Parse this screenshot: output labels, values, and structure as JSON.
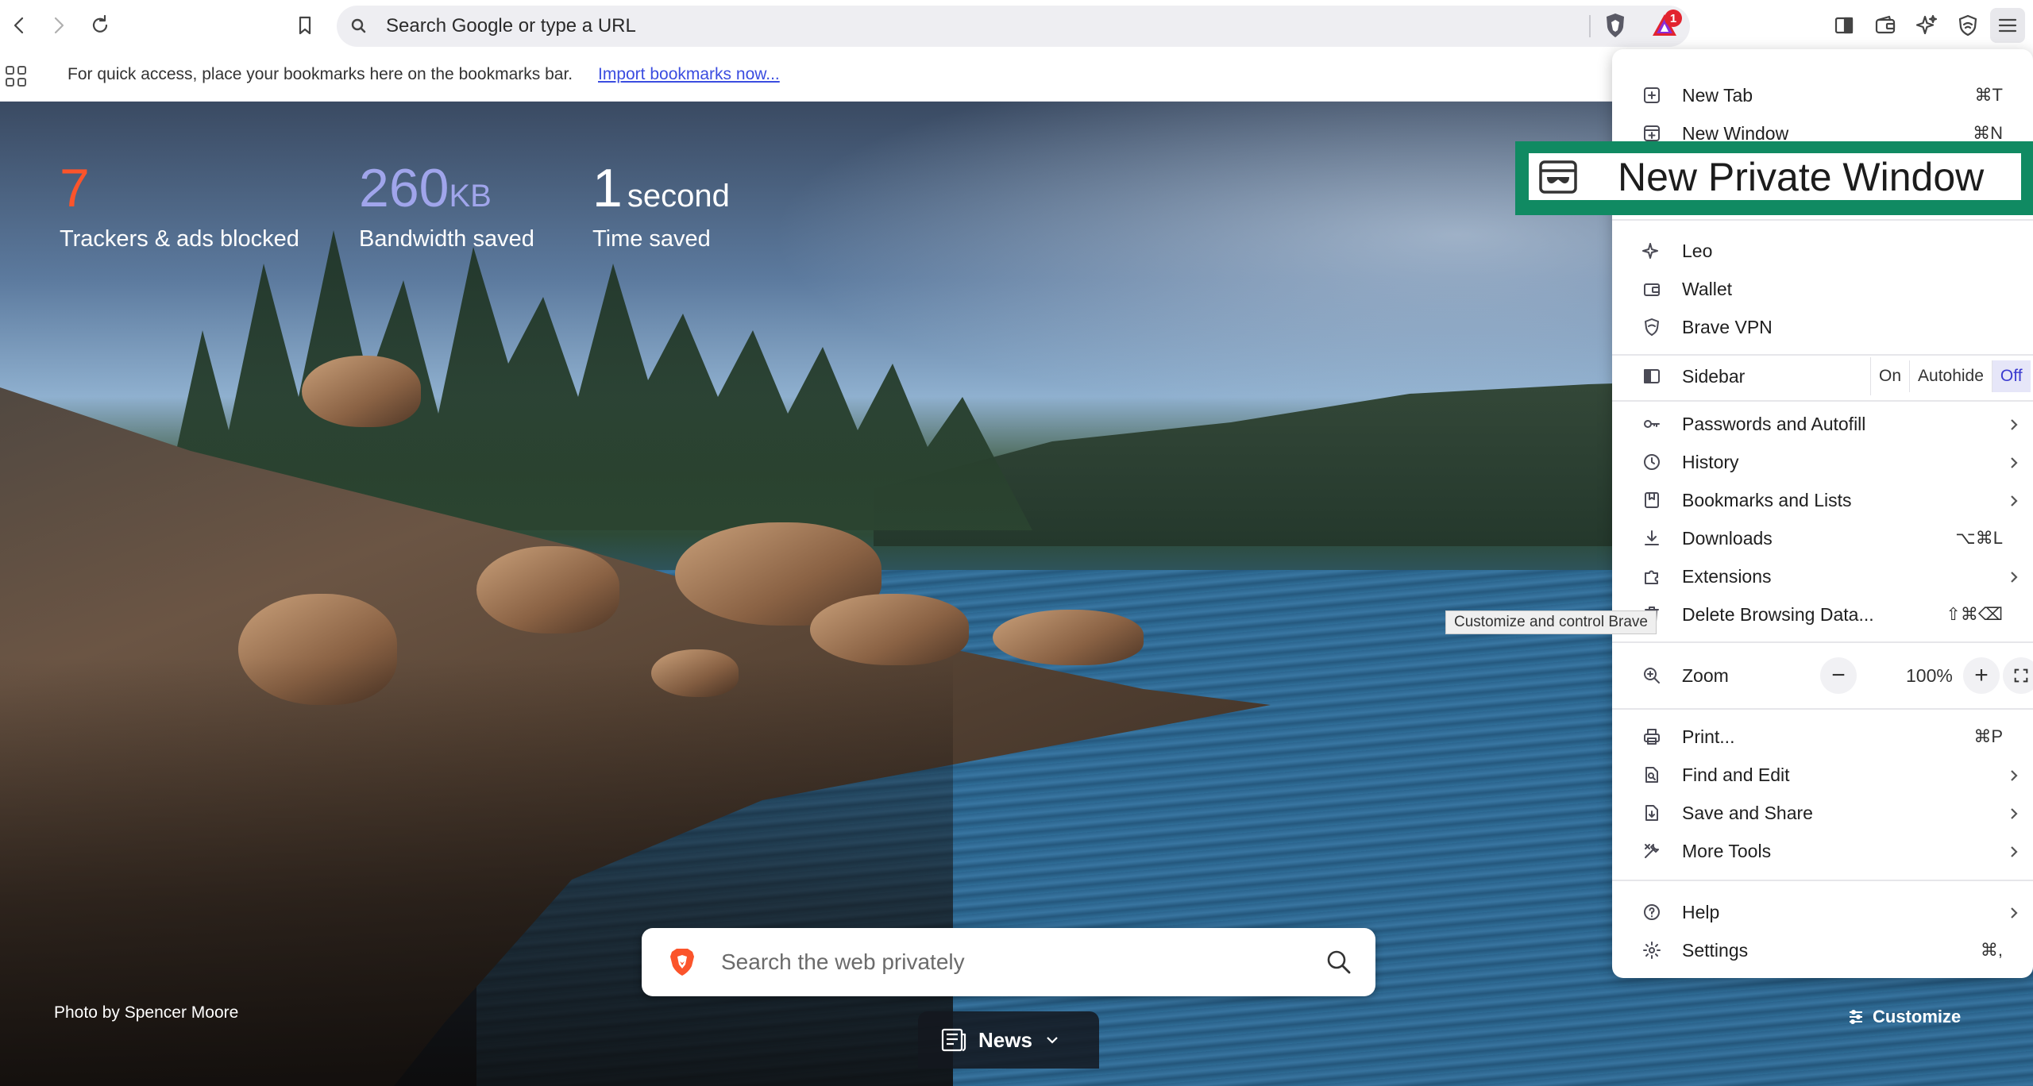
{
  "toolbar": {
    "search_placeholder": "Search Google or type a URL",
    "rewards_badge": "1"
  },
  "bookmarks_bar": {
    "hint": "For quick access, place your bookmarks here on the bookmarks bar.",
    "import_link": "Import bookmarks now..."
  },
  "stats": {
    "trackers_value": "7",
    "trackers_label": "Trackers & ads blocked",
    "bandwidth_value": "260",
    "bandwidth_unit": "KB",
    "bandwidth_label": "Bandwidth saved",
    "time_value": "1",
    "time_unit": "second",
    "time_label": "Time saved",
    "trackers_color": "#fb542b",
    "bandwidth_color": "#a0a5eb"
  },
  "ntp": {
    "photo_credit": "Photo by Spencer Moore",
    "search_placeholder": "Search the web privately",
    "news_label": "News",
    "customize_label": "Customize"
  },
  "menu": {
    "new_tab": {
      "label": "New Tab",
      "shortcut": "⌘T"
    },
    "new_window": {
      "label": "New Window",
      "shortcut": "⌘N"
    },
    "new_private_window": {
      "label": "New Private Window"
    },
    "leo": {
      "label": "Leo"
    },
    "wallet": {
      "label": "Wallet"
    },
    "vpn": {
      "label": "Brave VPN"
    },
    "sidebar": {
      "label": "Sidebar",
      "on": "On",
      "autohide": "Autohide",
      "off": "Off",
      "selected": "Off"
    },
    "passwords": {
      "label": "Passwords and Autofill"
    },
    "history": {
      "label": "History"
    },
    "bookmarks": {
      "label": "Bookmarks and Lists"
    },
    "downloads": {
      "label": "Downloads",
      "shortcut": "⌥⌘L"
    },
    "extensions": {
      "label": "Extensions"
    },
    "delete_data": {
      "label": "Delete Browsing Data...",
      "shortcut": "⇧⌘⌫"
    },
    "zoom": {
      "label": "Zoom",
      "minus": "−",
      "value": "100%",
      "plus": "+"
    },
    "print": {
      "label": "Print...",
      "shortcut": "⌘P"
    },
    "find_edit": {
      "label": "Find and Edit"
    },
    "save_share": {
      "label": "Save and Share"
    },
    "more_tools": {
      "label": "More Tools"
    },
    "help": {
      "label": "Help"
    },
    "settings": {
      "label": "Settings",
      "shortcut": "⌘,"
    }
  },
  "tooltip": "Customize and control Brave",
  "colors": {
    "highlight_border": "#108a62",
    "badge": "#e2232e",
    "link": "#3b4de0"
  }
}
